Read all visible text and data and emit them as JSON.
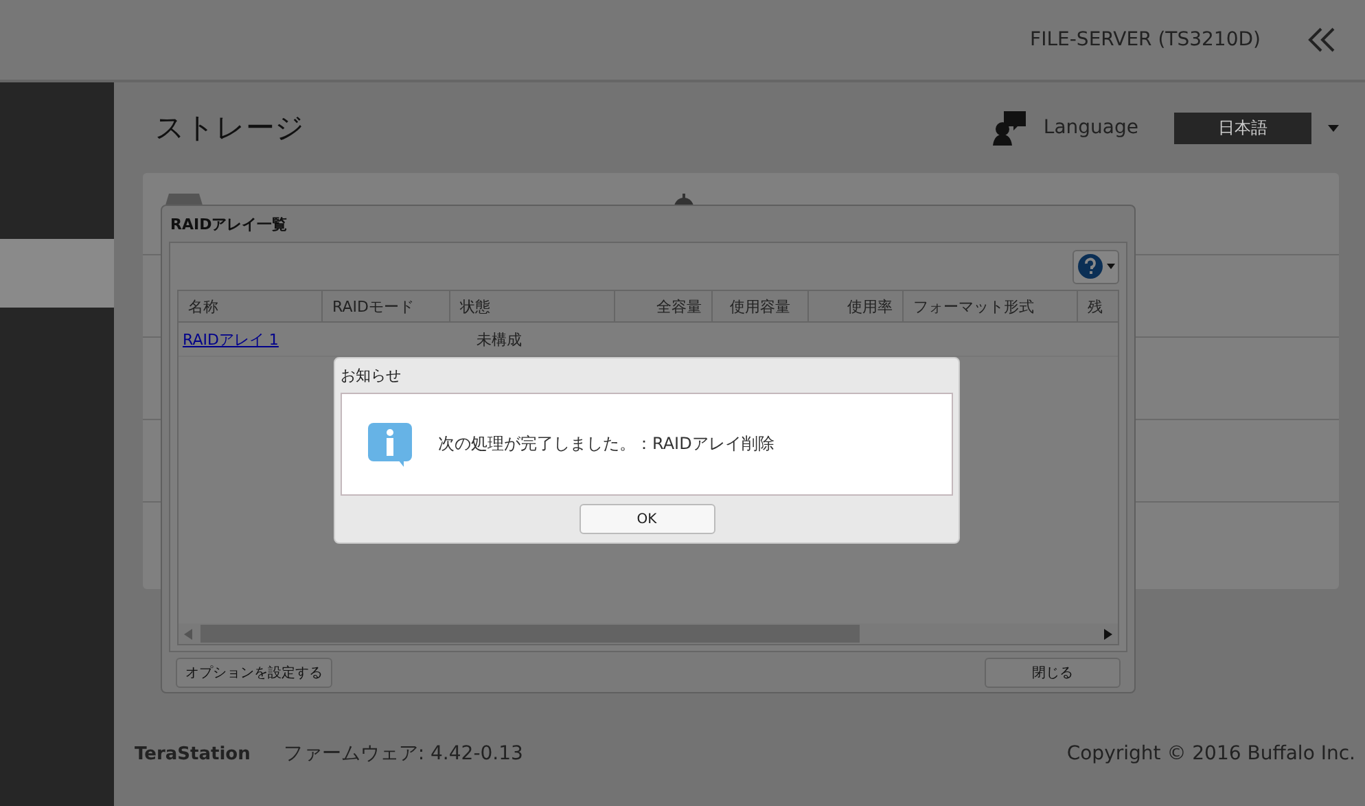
{
  "header": {
    "device": "FILE-SERVER (TS3210D)"
  },
  "sidebar": {
    "items": [
      {
        "selected": true
      }
    ]
  },
  "page": {
    "title": "ストレージ",
    "language_label": "Language",
    "language": "日本語"
  },
  "raid_dialog": {
    "title": "RAIDアレイ一覧",
    "columns": [
      "名称",
      "RAIDモード",
      "状態",
      "全容量",
      "使用容量",
      "使用率",
      "フォーマット形式",
      "残"
    ],
    "rows": [
      {
        "name": "RAIDアレイ 1",
        "status": "未構成"
      }
    ],
    "buttons": [
      "オプションを設定する",
      "閉じる"
    ]
  },
  "notice": {
    "title": "お知らせ",
    "message": "次の処理が完了しました。：RAIDアレイ削除",
    "button": "OK"
  },
  "footer": {
    "brand": "TeraStation",
    "firmware": "ファームウェア: 4.42-0.13",
    "copyright": "Copyright © 2016 Buffalo Inc."
  }
}
